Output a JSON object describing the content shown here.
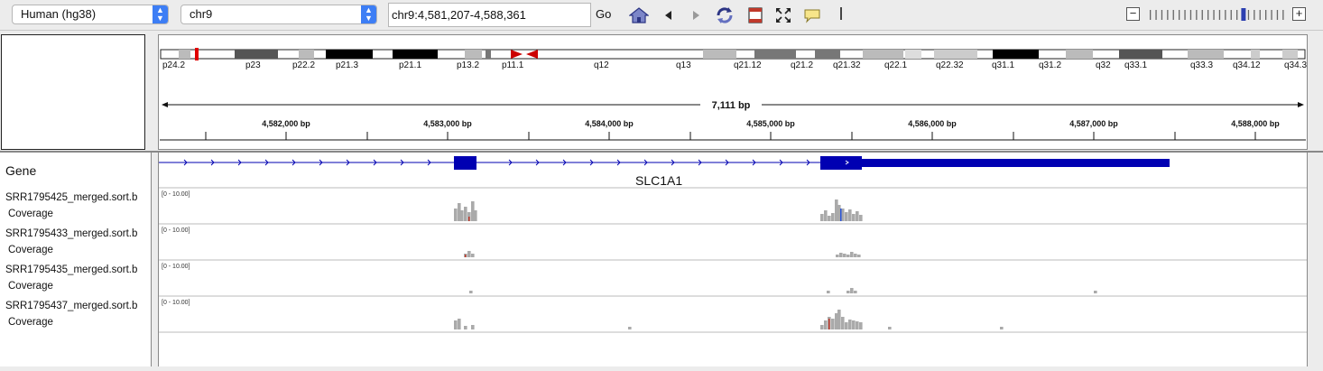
{
  "toolbar": {
    "genome": "Human (hg38)",
    "chromosome": "chr9",
    "locus": "chr9:4,581,207-4,588,361",
    "go_label": "Go",
    "icons": [
      "home-icon",
      "back-icon",
      "forward-icon",
      "refresh-icon",
      "roi-icon",
      "fit-icon",
      "popup-text-icon",
      "separator"
    ],
    "zoom_minus": "−",
    "zoom_plus": "+"
  },
  "ideogram": {
    "bands": [
      "p24.2",
      "p23",
      "p22.2",
      "p21.3",
      "p21.1",
      "p13.2",
      "p11.1",
      "q12",
      "q13",
      "q21.12",
      "q21.2",
      "q21.32",
      "q22.1",
      "q22.32",
      "q31.1",
      "q31.2",
      "q32",
      "q33.1",
      "q33.3",
      "q34.12",
      "q34.3"
    ]
  },
  "ruler": {
    "span_label": "7,111 bp",
    "tick_labels": [
      "4,582,000 bp",
      "4,583,000 bp",
      "4,584,000 bp",
      "4,585,000 bp",
      "4,586,000 bp",
      "4,587,000 bp",
      "4,588,000 bp"
    ]
  },
  "gene_track": {
    "name": "Gene",
    "gene_name": "SLC1A1",
    "color": "#0000b2"
  },
  "coverage_tracks": [
    {
      "name": "SRR1795425_merged.sort.b",
      "subtitle": "Coverage",
      "range_label": "[0 - 10.00]"
    },
    {
      "name": "SRR1795433_merged.sort.b",
      "subtitle": "Coverage",
      "range_label": "[0 - 10.00]"
    },
    {
      "name": "SRR1795435_merged.sort.b",
      "subtitle": "Coverage",
      "range_label": "[0 - 10.00]"
    },
    {
      "name": "SRR1795437_merged.sort.b",
      "subtitle": "Coverage",
      "range_label": "[0 - 10.00]"
    }
  ],
  "colors": {
    "coverage": "#aaaaaa",
    "mismatch_red": "#c0392b",
    "mismatch_blue": "#2a55d8",
    "accent": "#3d7ef5"
  }
}
